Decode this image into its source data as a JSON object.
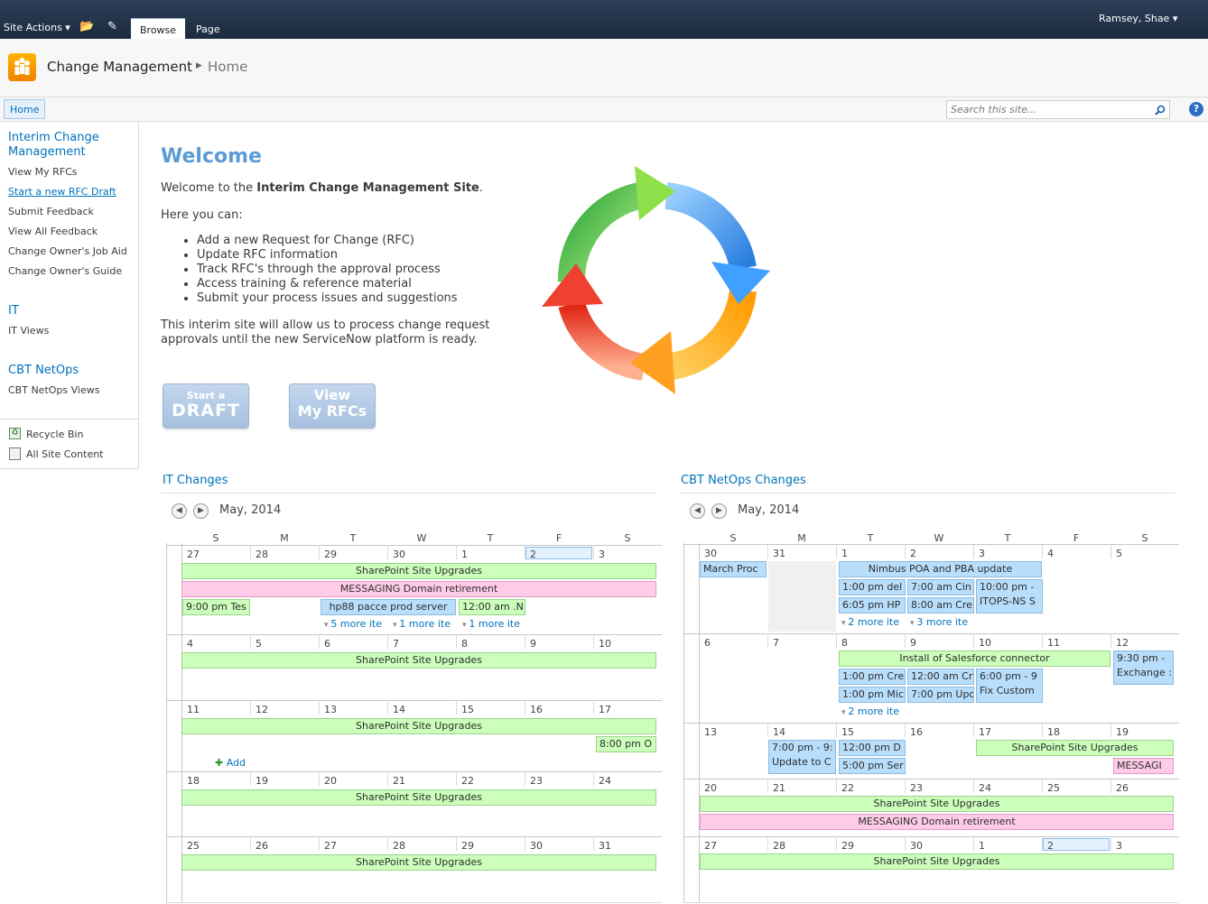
{
  "ribbon": {
    "site_actions": "Site Actions",
    "tab_browse": "Browse",
    "tab_page": "Page",
    "user": "Ramsey, Shae"
  },
  "title": {
    "site": "Change Management",
    "page": "Home"
  },
  "topnav": {
    "home": "Home",
    "search_placeholder": "Search this site..."
  },
  "leftnav": {
    "group1_title": "Interim Change Management",
    "group1_items": [
      "View My RFCs",
      "Start a new RFC Draft",
      "Submit Feedback",
      "View All Feedback",
      "Change Owner's Job Aid",
      "Change Owner's Guide"
    ],
    "group2_title": "IT",
    "group2_items": [
      "IT Views"
    ],
    "group3_title": "CBT NetOps",
    "group3_items": [
      "CBT NetOps Views"
    ],
    "recycle": "Recycle Bin",
    "all_content": "All Site Content"
  },
  "welcome": {
    "heading": "Welcome",
    "intro_pre": "Welcome to the ",
    "intro_bold": "Interim Change Management Site",
    "intro_post": ".",
    "here": "Here you can:",
    "bullets": [
      "Add a new Request for Change (RFC)",
      "Update RFC information",
      "Track RFC's through the approval process",
      "Access training & reference material",
      "Submit your process issues and suggestions"
    ],
    "para_line1": "This interim site will allow us to process change request",
    "para_line2": "approvals until the new ServiceNow platform is ready.",
    "btn1_small": "Start a",
    "btn1_big": "DRAFT",
    "btn2_line1": "View",
    "btn2_line2": "My RFCs"
  },
  "colors": {
    "green_event": "#ccffbb",
    "pink_event": "#ffcce8",
    "blue_event": "#b8defc",
    "link": "#0072bc",
    "welcome": "#5b9bd5"
  },
  "cal1": {
    "title": "IT Changes",
    "month": "May, 2014",
    "dow": [
      "S",
      "M",
      "T",
      "W",
      "T",
      "F",
      "S"
    ],
    "days": [
      [
        "27",
        "28",
        "29",
        "30",
        "1",
        "2",
        "3"
      ],
      [
        "4",
        "5",
        "6",
        "7",
        "8",
        "9",
        "10"
      ],
      [
        "11",
        "12",
        "13",
        "14",
        "15",
        "16",
        "17"
      ],
      [
        "18",
        "19",
        "20",
        "21",
        "22",
        "23",
        "24"
      ],
      [
        "25",
        "26",
        "27",
        "28",
        "29",
        "30",
        "31"
      ]
    ],
    "ev_sp": "SharePoint Site Upgrades",
    "ev_msg": "MESSAGING Domain retirement",
    "ev_tes": "9:00 pm Tes",
    "ev_hp88": "hp88 pacce prod server",
    "ev_1200": "12:00 am .N",
    "more1": "5 more ite",
    "more2": "1 more ite",
    "more3": "1 more ite",
    "ev_800": "8:00 pm O",
    "add": "Add"
  },
  "cal2": {
    "title": "CBT NetOps Changes",
    "month": "May, 2014",
    "dow": [
      "S",
      "M",
      "T",
      "W",
      "T",
      "F",
      "S"
    ],
    "days": [
      [
        "30",
        "31",
        "1",
        "2",
        "3",
        "4",
        "5"
      ],
      [
        "6",
        "7",
        "8",
        "9",
        "10",
        "11",
        "12"
      ],
      [
        "13",
        "14",
        "15",
        "16",
        "17",
        "18",
        "19"
      ],
      [
        "20",
        "21",
        "22",
        "23",
        "24",
        "25",
        "26"
      ],
      [
        "27",
        "28",
        "29",
        "30",
        "1",
        "2",
        "3"
      ]
    ],
    "ev_march": "March Proc",
    "ev_nimbus": "Nimbus POA and PBA update",
    "ev_100del": "1:00 pm del",
    "ev_700cin": "7:00 am Cin",
    "ev_1000": "10:00 pm -",
    "ev_itops": "ITOPS-NS S",
    "ev_605": "6:05 pm HP",
    "ev_800cre": "8:00 am Cre",
    "more1": "2 more ite",
    "more2": "3 more ite",
    "ev_salesforce": "Install of Salesforce connector",
    "ev_930": "9:30 pm -",
    "ev_exchange": "Exchange :",
    "ev_100cre": "1:00 pm Cre",
    "ev_1200cr": "12:00 am Cr",
    "ev_600": "6:00 pm - 9",
    "ev_fix": "Fix Custom",
    "ev_100mic": "1:00 pm Mic",
    "ev_700upc": "7:00 pm Upc",
    "more3": "2 more ite",
    "ev_700pm9": "7:00 pm - 9:",
    "ev_update": "Update to C",
    "ev_1200d": "12:00 pm D",
    "ev_500": "5:00 pm Ser",
    "ev_sp": "SharePoint Site Upgrades",
    "ev_messagi": "MESSAGI",
    "ev_msg": "MESSAGING Domain retirement"
  }
}
